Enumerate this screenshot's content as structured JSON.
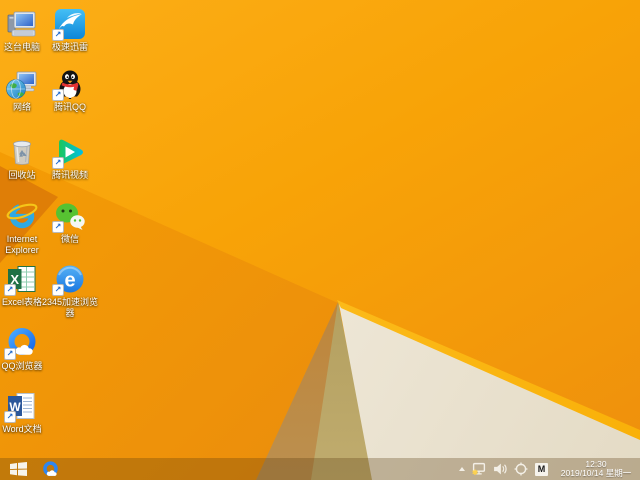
{
  "colors": {
    "orange_base": "#F8A307",
    "orange_dark": "#E98A0E",
    "fold_dark": "#DF7E07",
    "shadow_wedge": "#C08335",
    "olive": "#A28E4C",
    "cream": "#F5EFE3",
    "edge_highlight": "#FFC62E",
    "taskbar_tint": "rgba(90,60,15,0.30)"
  },
  "desktop": {
    "icons": [
      {
        "label": "这台电脑",
        "icon": "this-pc-icon"
      },
      {
        "label": "极速迅雷",
        "icon": "xunlei-icon"
      },
      {
        "label": "网络",
        "icon": "network-icon"
      },
      {
        "label": "腾讯QQ",
        "icon": "tencent-qq-icon"
      },
      {
        "label": "回收站",
        "icon": "recycle-bin-icon"
      },
      {
        "label": "腾讯视频",
        "icon": "tencent-video-icon"
      },
      {
        "label": "Internet Explorer",
        "icon": "internet-explorer-icon"
      },
      {
        "label": "微信",
        "icon": "wechat-icon"
      },
      {
        "label": "Excel表格",
        "icon": "excel-icon"
      },
      {
        "label": "2345加速浏览器",
        "icon": "2345-browser-icon"
      },
      {
        "label": "QQ浏览器",
        "icon": "qq-browser-icon"
      },
      {
        "label": "Word文档",
        "icon": "word-icon"
      }
    ]
  },
  "taskbar": {
    "start_icon": "windows-logo-icon",
    "pinned": [
      {
        "icon": "qq-browser-icon"
      }
    ],
    "tray": {
      "icons": [
        "hidden-icons-chevron",
        "network-status-icon",
        "volume-icon",
        "safety-icon",
        "input-method-indicator"
      ],
      "input_method": "M",
      "time": "12:30",
      "date": "2019/10/14 星期一"
    }
  }
}
